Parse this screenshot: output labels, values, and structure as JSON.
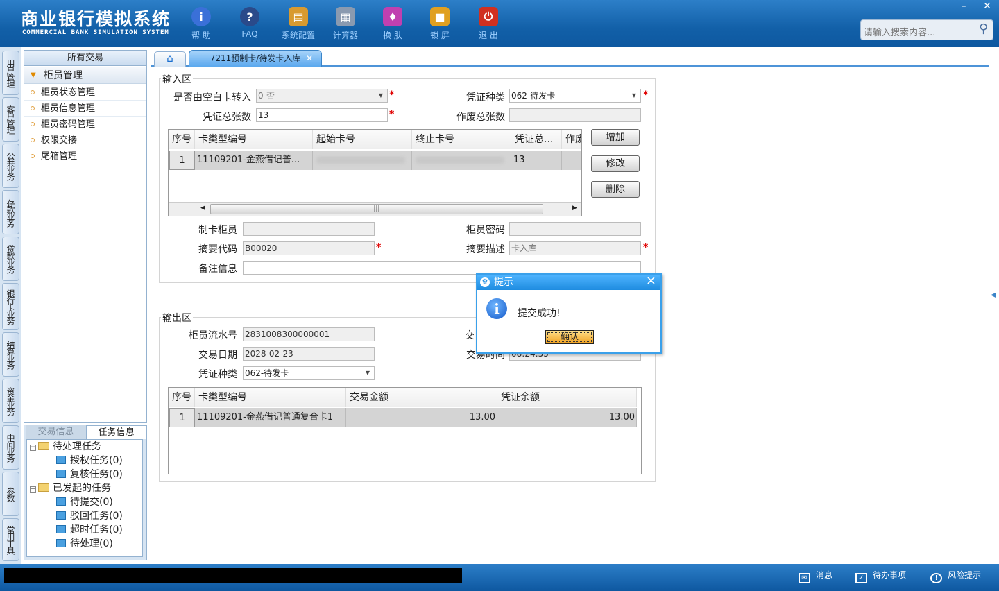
{
  "header": {
    "title_cn": "商业银行模拟系统",
    "title_en": "COMMERCIAL BANK SIMULATION SYSTEM",
    "toolbar": [
      {
        "label": "帮 助",
        "icon": "info-icon"
      },
      {
        "label": "FAQ",
        "icon": "question-icon"
      },
      {
        "label": "系统配置",
        "icon": "toolbox-icon"
      },
      {
        "label": "计算器",
        "icon": "calculator-icon"
      },
      {
        "label": "换 肤",
        "icon": "shirt-icon"
      },
      {
        "label": "锁 屏",
        "icon": "lock-icon"
      },
      {
        "label": "退 出",
        "icon": "power-icon"
      }
    ],
    "search_placeholder": "请输入搜索内容..."
  },
  "vnav": [
    "用户管理",
    "客户管理",
    "公共业务",
    "存款业务",
    "贷款业务",
    "银行卡业务",
    "结算业务",
    "资金业务",
    "中间业务",
    "参数",
    "常用工具"
  ],
  "left_panel": {
    "header": "所有交易",
    "group": "柜员管理",
    "items": [
      "柜员状态管理",
      "柜员信息管理",
      "柜员密码管理",
      "权限交接",
      "尾箱管理"
    ]
  },
  "bottom_panel": {
    "tabs": [
      "交易信息",
      "任务信息"
    ],
    "tree": [
      {
        "label": "待处理任务",
        "children": [
          "授权任务(0)",
          "复核任务(0)"
        ]
      },
      {
        "label": "已发起的任务",
        "children": [
          "待提交(0)",
          "驳回任务(0)",
          "超时任务(0)",
          "待处理(0)"
        ]
      }
    ]
  },
  "tabs": {
    "active": "7211预制卡/待发卡入库"
  },
  "input": {
    "legend": "输入区",
    "blank_card_label": "是否由空白卡转入",
    "blank_card_value": "0-否",
    "voucher_type_label": "凭证种类",
    "voucher_type_value": "062-待发卡",
    "voucher_total_label": "凭证总张数",
    "voucher_total_value": "13",
    "void_total_label": "作废总张数",
    "void_total_value": "",
    "grid": {
      "headers": [
        "序号",
        "卡类型编号",
        "起始卡号",
        "终止卡号",
        "凭证总...",
        "作废"
      ],
      "row": [
        "1",
        "11109201-金燕借记普...",
        "",
        "",
        "13",
        ""
      ]
    },
    "buttons": [
      "增加",
      "修改",
      "删除"
    ],
    "maker_label": "制卡柜员",
    "maker_value": "",
    "teller_pwd_label": "柜员密码",
    "teller_pwd_value": "",
    "summary_code_label": "摘要代码",
    "summary_code_value": "B00020",
    "summary_desc_label": "摘要描述",
    "summary_desc_value": "卡入库",
    "remark_label": "备注信息",
    "remark_value": ""
  },
  "output": {
    "legend": "输出区",
    "serial_label": "柜员流水号",
    "serial_value": "2831008300000001",
    "trade_code_label": "交",
    "date_label": "交易日期",
    "date_value": "2028-02-23",
    "time_label": "交易时间",
    "time_value": "08:24:55",
    "voucher_type_label": "凭证种类",
    "voucher_type_value": "062-待发卡",
    "grid": {
      "headers": [
        "序号",
        "卡类型编号",
        "交易金额",
        "凭证余额"
      ],
      "row": [
        "1",
        "11109201-金燕借记普通复合卡1",
        "13.00",
        "13.00"
      ]
    }
  },
  "dialog": {
    "title": "提示",
    "message": "提交成功!",
    "ok": "确认"
  },
  "status": {
    "items": [
      "消息",
      "待办事项",
      "风险提示"
    ]
  }
}
